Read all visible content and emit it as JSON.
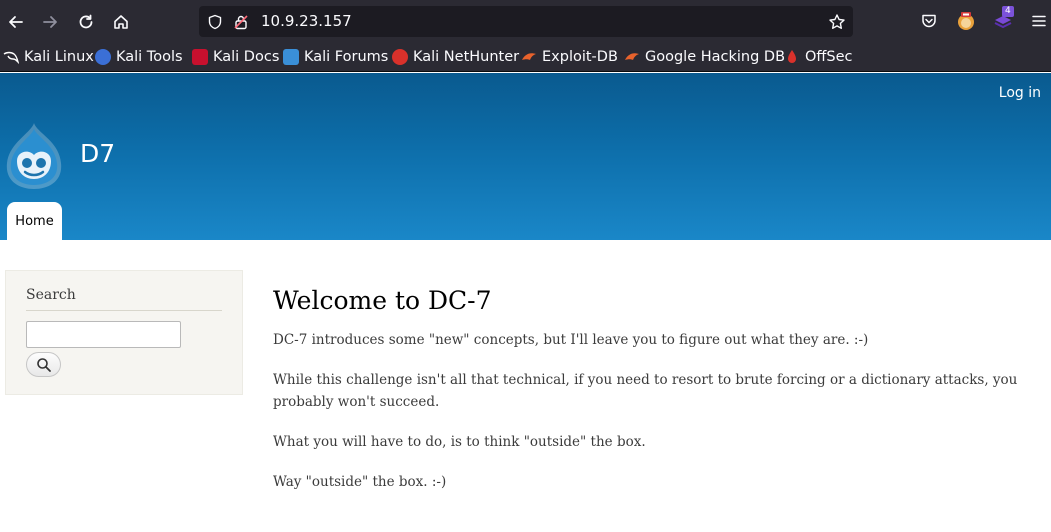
{
  "browser": {
    "url": "10.9.23.157",
    "extension_badge": "4",
    "bookmarks": [
      {
        "label": "Kali Linux",
        "icon": "kali-dragon-icon",
        "color": "#1e1e1e"
      },
      {
        "label": "Kali Tools",
        "icon": "kali-tools-icon",
        "color": "#3b6fd6"
      },
      {
        "label": "Kali Docs",
        "icon": "kali-docs-icon",
        "color": "#c8102e"
      },
      {
        "label": "Kali Forums",
        "icon": "kali-forums-icon",
        "color": "#3a8fd8"
      },
      {
        "label": "Kali NetHunter",
        "icon": "nethunter-icon",
        "color": "#d9312b"
      },
      {
        "label": "Exploit-DB",
        "icon": "exploit-db-icon",
        "color": "#e8622c"
      },
      {
        "label": "Google Hacking DB",
        "icon": "ghdb-icon",
        "color": "#e8622c"
      },
      {
        "label": "OffSec",
        "icon": "offsec-icon",
        "color": "#d9312b"
      }
    ]
  },
  "site": {
    "login": "Log in",
    "name": "D7",
    "nav": {
      "home": "Home"
    },
    "sidebar": {
      "search_title": "Search",
      "search_value": ""
    },
    "content": {
      "title": "Welcome to DC-7",
      "paragraphs": [
        "DC-7 introduces some \"new\" concepts, but I'll leave you to figure out what they are.  :-)",
        "While this challenge isn't all that technical, if you need to resort to brute forcing or a dictionary attacks, you probably won't succeed.",
        "What you will have to do, is to think \"outside\" the box.",
        "Way \"outside\" the box.  :-)"
      ]
    }
  },
  "colors": {
    "header_top": "#0a5a8f",
    "header_bottom": "#1a87c8",
    "chrome": "#2b2a33",
    "sidebar_bg": "#f6f5f1"
  }
}
